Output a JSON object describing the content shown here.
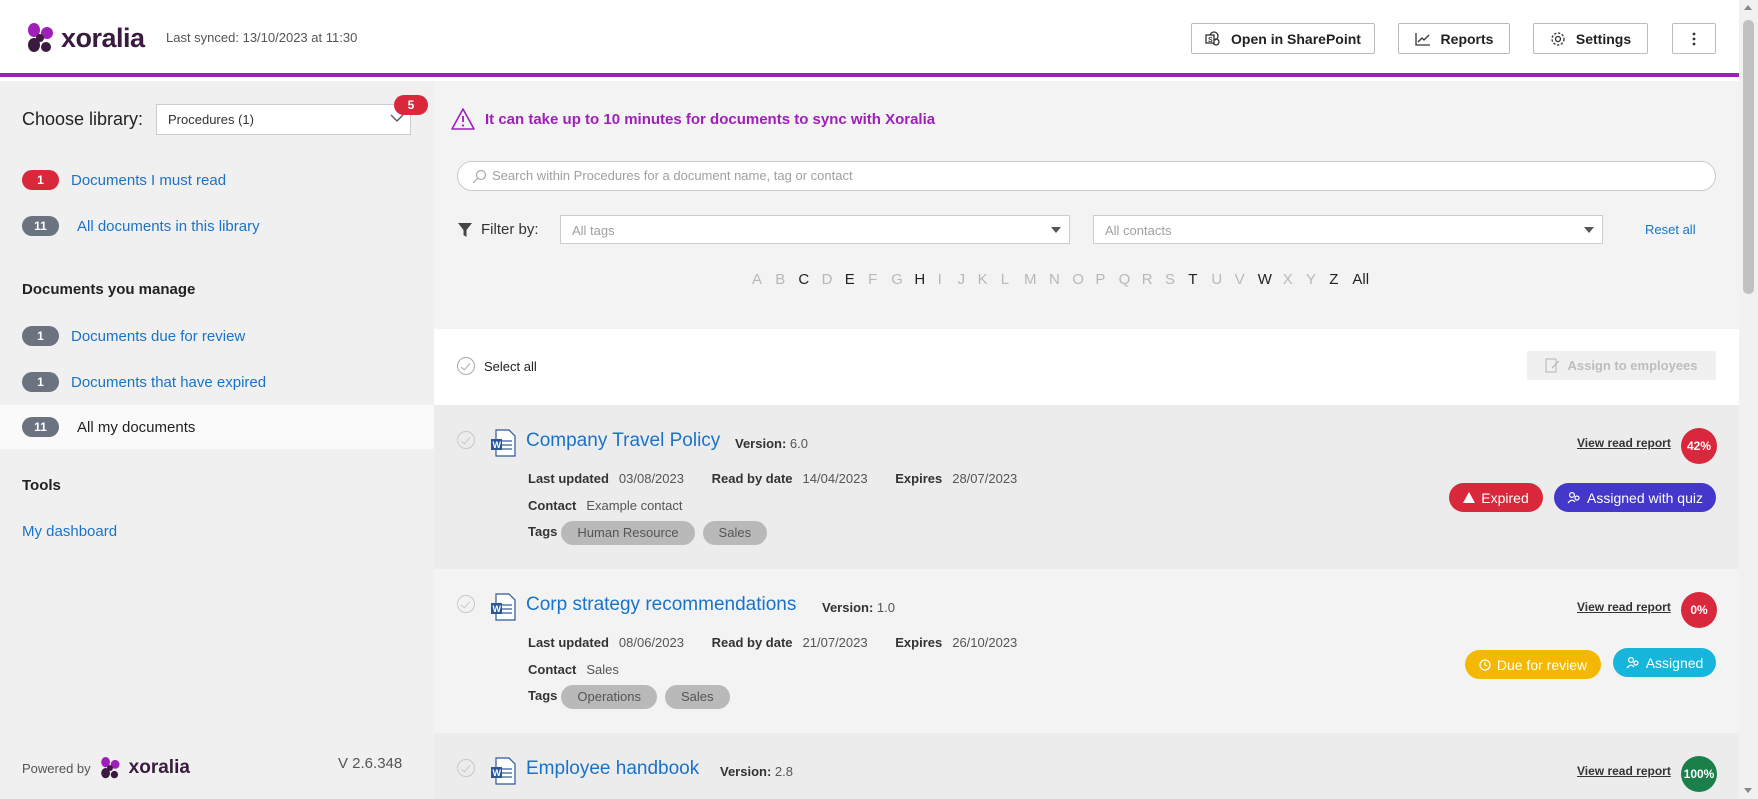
{
  "header": {
    "logo_text": "xoralia",
    "last_synced": "Last synced: 13/10/2023 at 11:30",
    "buttons": {
      "sharepoint": "Open in SharePoint",
      "reports": "Reports",
      "settings": "Settings"
    }
  },
  "sidebar": {
    "choose_label": "Choose library:",
    "library_value": "Procedures (1)",
    "library_badge": "5",
    "items": [
      {
        "count": "1",
        "label": "Documents I must read"
      },
      {
        "count": "11",
        "label": "All documents in this library"
      }
    ],
    "manage_heading": "Documents you manage",
    "manage_items": [
      {
        "count": "1",
        "label": "Documents due for review"
      },
      {
        "count": "1",
        "label": "Documents that have expired"
      },
      {
        "count": "11",
        "label": "All my documents"
      }
    ],
    "tools_heading": "Tools",
    "tools_link": "My dashboard",
    "powered_by": "Powered by",
    "powered_logo": "xoralia",
    "version": "V 2.6.348"
  },
  "main": {
    "warning": "It can take up to 10 minutes for documents to sync with Xoralia",
    "search_placeholder": "Search within Procedures for a document name, tag or contact",
    "filter_label": "Filter by:",
    "tags_placeholder": "All tags",
    "contacts_placeholder": "All contacts",
    "reset_all": "Reset all",
    "letters": [
      "A",
      "B",
      "C",
      "D",
      "E",
      "F",
      "G",
      "H",
      "I",
      "J",
      "K",
      "L",
      "M",
      "N",
      "O",
      "P",
      "Q",
      "R",
      "S",
      "T",
      "U",
      "V",
      "W",
      "X",
      "Y",
      "Z",
      "All"
    ],
    "active_letters": [
      "C",
      "E",
      "H",
      "T",
      "W",
      "Z",
      "All"
    ],
    "select_all": "Select all",
    "assign_button": "Assign to employees"
  },
  "labels": {
    "version": "Version:",
    "last_updated": "Last updated",
    "read_by": "Read by date",
    "expires": "Expires",
    "contact": "Contact",
    "tags": "Tags",
    "view_report": "View read report"
  },
  "documents": [
    {
      "title": "Company Travel Policy",
      "version": "6.0",
      "last_updated": "03/08/2023",
      "read_by": "14/04/2023",
      "expires": "28/07/2023",
      "contact": "Example contact",
      "tags": [
        "Human Resource",
        "Sales"
      ],
      "percent": "42%",
      "percent_color": "#d9283b",
      "status": "Expired",
      "status_color": "#d9283b",
      "assignment": "Assigned with quiz",
      "assignment_color": "#4338ca"
    },
    {
      "title": "Corp strategy recommendations",
      "version": "1.0",
      "last_updated": "08/06/2023",
      "read_by": "21/07/2023",
      "expires": "26/10/2023",
      "contact": "Sales",
      "tags": [
        "Operations",
        "Sales"
      ],
      "percent": "0%",
      "percent_color": "#d9283b",
      "status": "Due for review",
      "status_color": "#f5b800",
      "assignment": "Assigned",
      "assignment_color": "#16b6dc"
    },
    {
      "title": "Employee handbook",
      "version": "2.8",
      "percent": "100%",
      "percent_color": "#1a7f4b"
    }
  ],
  "colors": {
    "accent": "#a01fba",
    "link": "#1a73c8"
  }
}
